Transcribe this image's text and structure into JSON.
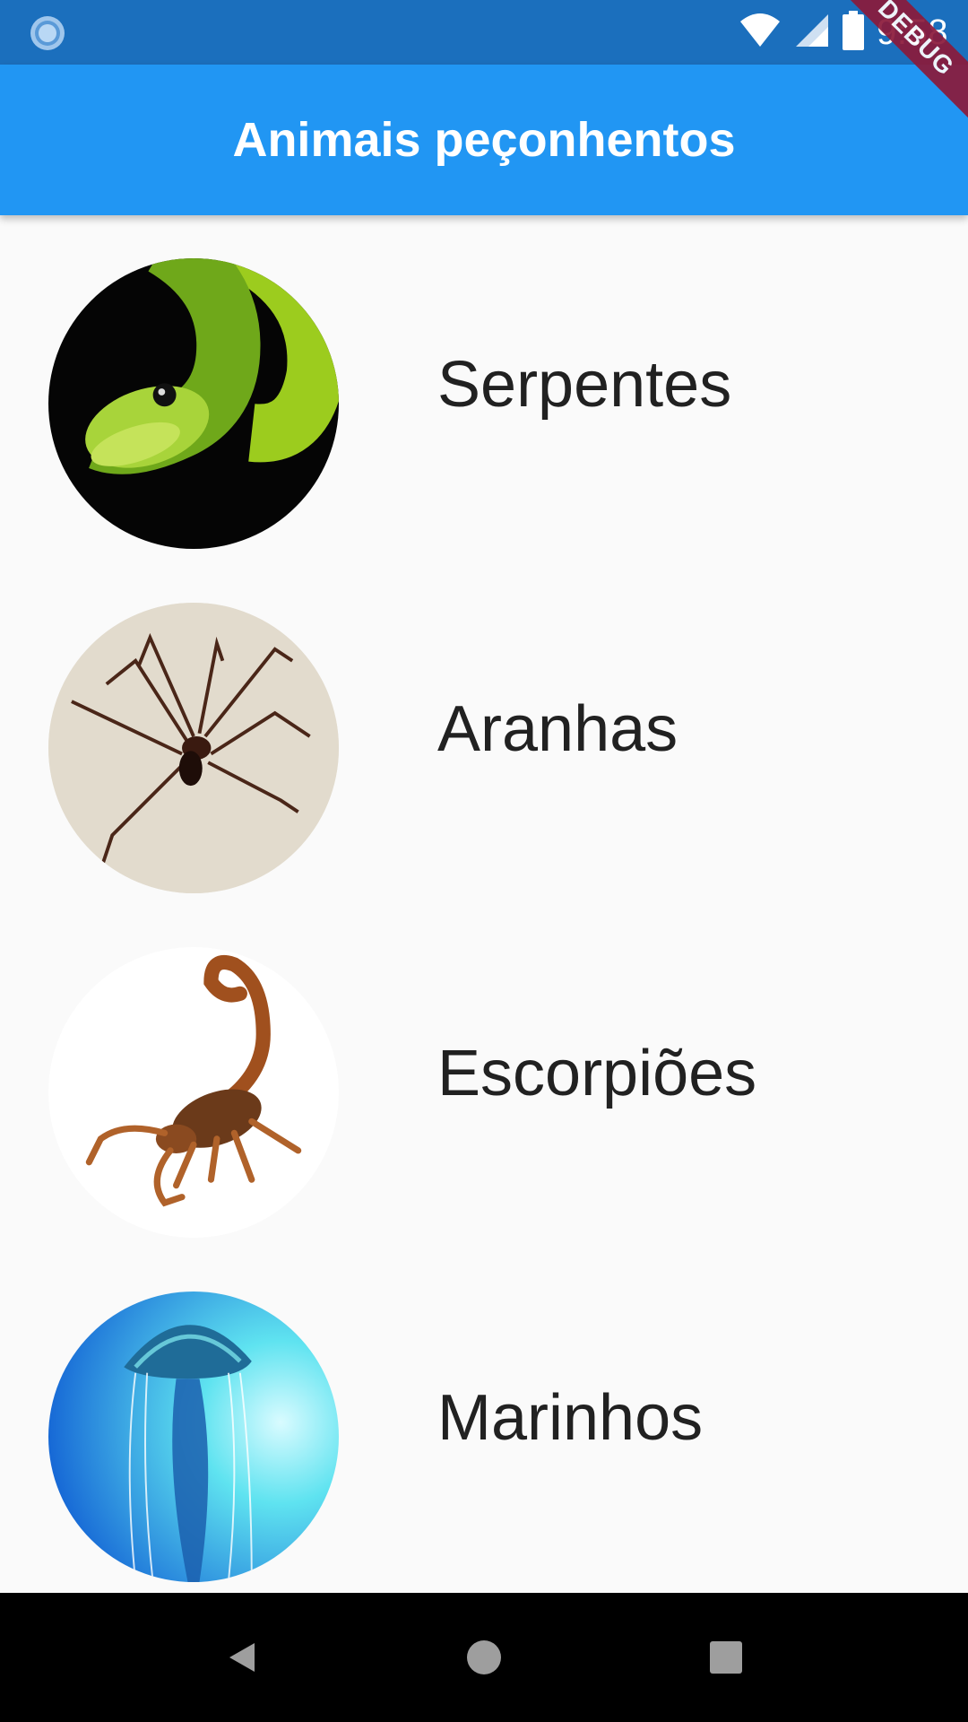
{
  "status_bar": {
    "time": "9:58",
    "icons": [
      "sync-icon",
      "wifi-icon",
      "cell-signal-icon",
      "battery-icon"
    ]
  },
  "app_bar": {
    "title": "Animais peçonhentos",
    "color": "#2196f3"
  },
  "debug_banner": "DEBUG",
  "categories": [
    {
      "label": "Serpentes",
      "image": "snake-photo"
    },
    {
      "label": "Aranhas",
      "image": "spider-photo"
    },
    {
      "label": "Escorpiões",
      "image": "scorpion-photo"
    },
    {
      "label": "Marinhos",
      "image": "jellyfish-photo"
    }
  ],
  "nav_bar": {
    "buttons": [
      "back-icon",
      "home-icon",
      "recents-icon"
    ]
  }
}
